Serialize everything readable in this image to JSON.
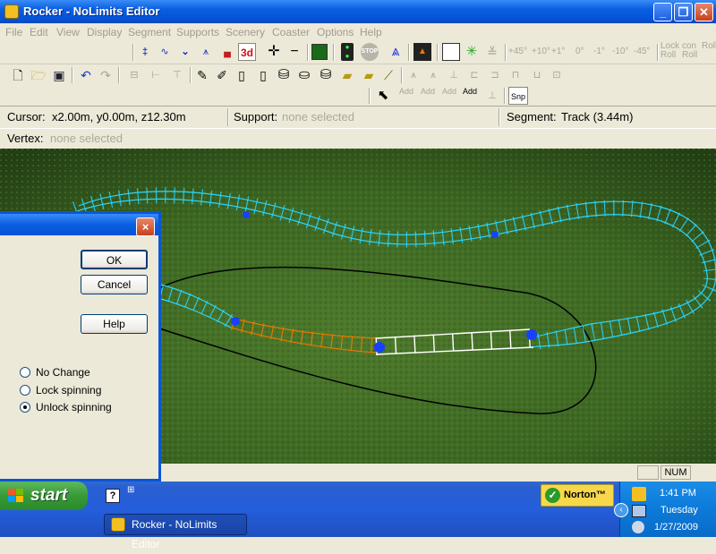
{
  "window": {
    "title": "Rocker - NoLimits Editor"
  },
  "menu": [
    "File",
    "Edit",
    "View",
    "Display",
    "Segment",
    "Supports",
    "Scenery",
    "Coaster",
    "Options",
    "Help"
  ],
  "toolbar": {
    "label_3d": "3d",
    "angles": [
      "+45°",
      "+10°",
      "+1°",
      "0°",
      "-1°",
      "-10°",
      "-45°"
    ],
    "lock_roll": [
      "Lock",
      "Roll"
    ],
    "con_roll": [
      "con",
      "Roll"
    ],
    "add_labels": [
      "Add",
      "Add",
      "Add",
      "Add"
    ],
    "snap": "Snp"
  },
  "status": {
    "cursor_label": "Cursor:",
    "cursor_value": "x2.00m, y0.00m, z12.30m",
    "support_label": "Support:",
    "support_value": "none selected",
    "segment_label": "Segment:",
    "segment_value": "Track (3.44m)",
    "vertex_label": "Vertex:",
    "vertex_value": "none selected"
  },
  "dialog": {
    "ok": "OK",
    "cancel": "Cancel",
    "help": "Help",
    "close": "×",
    "options": [
      {
        "label": "No Change",
        "selected": false
      },
      {
        "label": "Lock spinning",
        "selected": false
      },
      {
        "label": "Unlock spinning",
        "selected": true
      }
    ]
  },
  "bottom_status": {
    "num": "NUM"
  },
  "taskbar": {
    "start": "start",
    "task": "Rocker - NoLimits Editor",
    "norton": "Norton™",
    "time": "1:41 PM",
    "day": "Tuesday",
    "date": "1/27/2009"
  },
  "colors": {
    "track_cyan": "#2ad6ff",
    "track_selected": "#e07a00",
    "track_white": "#ffffff",
    "vertex_blue": "#1740ff",
    "grass": "#3f6a22"
  }
}
